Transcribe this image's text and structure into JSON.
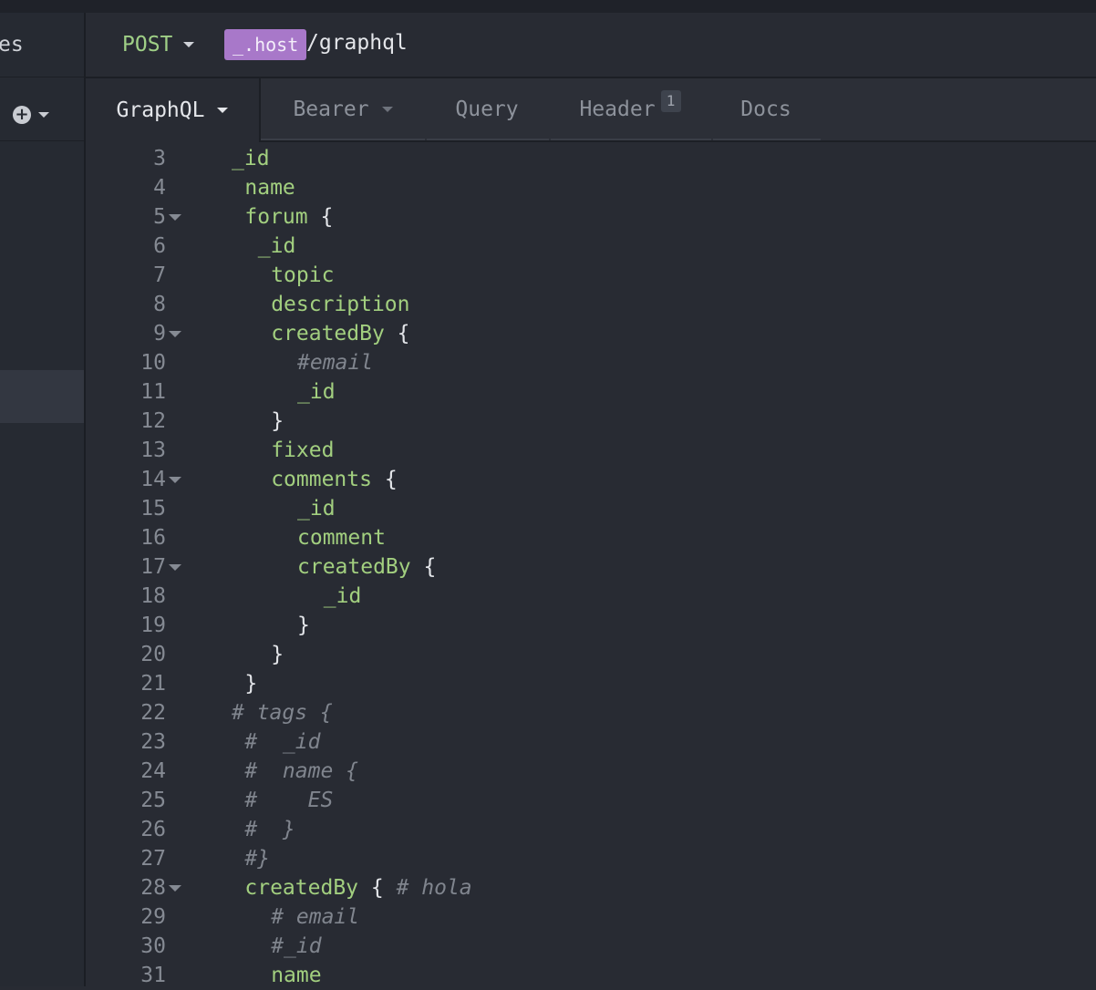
{
  "sidebar": {
    "truncated_label": "es",
    "add_icon": "plus-circle-icon",
    "add_caret_icon": "caret-down-icon"
  },
  "request": {
    "method": "POST",
    "host_variable": "_.host",
    "path": "/graphql"
  },
  "tabs": [
    {
      "label": "GraphQL",
      "has_dropdown": true,
      "active": true
    },
    {
      "label": "Bearer",
      "has_dropdown": true,
      "active": false
    },
    {
      "label": "Query",
      "has_dropdown": false,
      "active": false
    },
    {
      "label": "Header",
      "badge": "1",
      "has_dropdown": false,
      "active": false
    },
    {
      "label": "Docs",
      "has_dropdown": false,
      "active": false
    }
  ],
  "colors": {
    "field": "#a2cf7f",
    "punctuation": "#e4e6ea",
    "comment": "#80858e",
    "line_number": "#858a93",
    "variable_badge": "#a878c9",
    "method": "#9fcf86"
  },
  "editor": {
    "lines": [
      {
        "num": "3",
        "indent": 0,
        "fold": false,
        "parts": [
          {
            "t": "_id",
            "k": "fld"
          }
        ]
      },
      {
        "num": "4",
        "indent": 1,
        "fold": false,
        "parts": [
          {
            "t": "name",
            "k": "fld"
          }
        ]
      },
      {
        "num": "5",
        "indent": 1,
        "fold": true,
        "parts": [
          {
            "t": "forum",
            "k": "fld"
          },
          {
            "t": " {",
            "k": "pn"
          }
        ]
      },
      {
        "num": "6",
        "indent": 2,
        "fold": false,
        "parts": [
          {
            "t": "_id",
            "k": "fld"
          }
        ]
      },
      {
        "num": "7",
        "indent": 3,
        "fold": false,
        "parts": [
          {
            "t": "topic",
            "k": "fld"
          }
        ]
      },
      {
        "num": "8",
        "indent": 3,
        "fold": false,
        "parts": [
          {
            "t": "description",
            "k": "fld"
          }
        ]
      },
      {
        "num": "9",
        "indent": 3,
        "fold": true,
        "parts": [
          {
            "t": "createdBy",
            "k": "fld"
          },
          {
            "t": " {",
            "k": "pn"
          }
        ]
      },
      {
        "num": "10",
        "indent": 5,
        "fold": false,
        "parts": [
          {
            "t": "#email",
            "k": "cm"
          }
        ]
      },
      {
        "num": "11",
        "indent": 5,
        "fold": false,
        "parts": [
          {
            "t": "_id",
            "k": "fld"
          }
        ]
      },
      {
        "num": "12",
        "indent": 3,
        "fold": false,
        "parts": [
          {
            "t": "}",
            "k": "pn"
          }
        ]
      },
      {
        "num": "13",
        "indent": 3,
        "fold": false,
        "parts": [
          {
            "t": "fixed",
            "k": "fld"
          }
        ]
      },
      {
        "num": "14",
        "indent": 3,
        "fold": true,
        "parts": [
          {
            "t": "comments",
            "k": "fld"
          },
          {
            "t": " {",
            "k": "pn"
          }
        ]
      },
      {
        "num": "15",
        "indent": 5,
        "fold": false,
        "parts": [
          {
            "t": "_id",
            "k": "fld"
          }
        ]
      },
      {
        "num": "16",
        "indent": 5,
        "fold": false,
        "parts": [
          {
            "t": "comment",
            "k": "fld"
          }
        ]
      },
      {
        "num": "17",
        "indent": 5,
        "fold": true,
        "parts": [
          {
            "t": "createdBy",
            "k": "fld"
          },
          {
            "t": " {",
            "k": "pn"
          }
        ]
      },
      {
        "num": "18",
        "indent": 7,
        "fold": false,
        "parts": [
          {
            "t": "_id",
            "k": "fld"
          }
        ]
      },
      {
        "num": "19",
        "indent": 5,
        "fold": false,
        "parts": [
          {
            "t": "}",
            "k": "pn"
          }
        ]
      },
      {
        "num": "20",
        "indent": 3,
        "fold": false,
        "parts": [
          {
            "t": "}",
            "k": "pn"
          }
        ]
      },
      {
        "num": "21",
        "indent": 1,
        "fold": false,
        "parts": [
          {
            "t": "}",
            "k": "pn"
          }
        ]
      },
      {
        "num": "22",
        "indent": 0,
        "fold": false,
        "parts": [
          {
            "t": "# tags {",
            "k": "cm"
          }
        ]
      },
      {
        "num": "23",
        "indent": 1,
        "fold": false,
        "parts": [
          {
            "t": "#  _id",
            "k": "cm"
          }
        ]
      },
      {
        "num": "24",
        "indent": 1,
        "fold": false,
        "parts": [
          {
            "t": "#  name {",
            "k": "cm"
          }
        ]
      },
      {
        "num": "25",
        "indent": 1,
        "fold": false,
        "parts": [
          {
            "t": "#    ES",
            "k": "cm"
          }
        ]
      },
      {
        "num": "26",
        "indent": 1,
        "fold": false,
        "parts": [
          {
            "t": "#  }",
            "k": "cm"
          }
        ]
      },
      {
        "num": "27",
        "indent": 1,
        "fold": false,
        "parts": [
          {
            "t": "#}",
            "k": "cm"
          }
        ]
      },
      {
        "num": "28",
        "indent": 1,
        "fold": true,
        "parts": [
          {
            "t": "createdBy",
            "k": "fld"
          },
          {
            "t": " { ",
            "k": "pn"
          },
          {
            "t": "# hola",
            "k": "cm"
          }
        ]
      },
      {
        "num": "29",
        "indent": 3,
        "fold": false,
        "parts": [
          {
            "t": "# email",
            "k": "cm"
          }
        ]
      },
      {
        "num": "30",
        "indent": 3,
        "fold": false,
        "parts": [
          {
            "t": "#_id",
            "k": "cm"
          }
        ]
      },
      {
        "num": "31",
        "indent": 3,
        "fold": false,
        "parts": [
          {
            "t": "name",
            "k": "fld"
          }
        ]
      }
    ]
  }
}
